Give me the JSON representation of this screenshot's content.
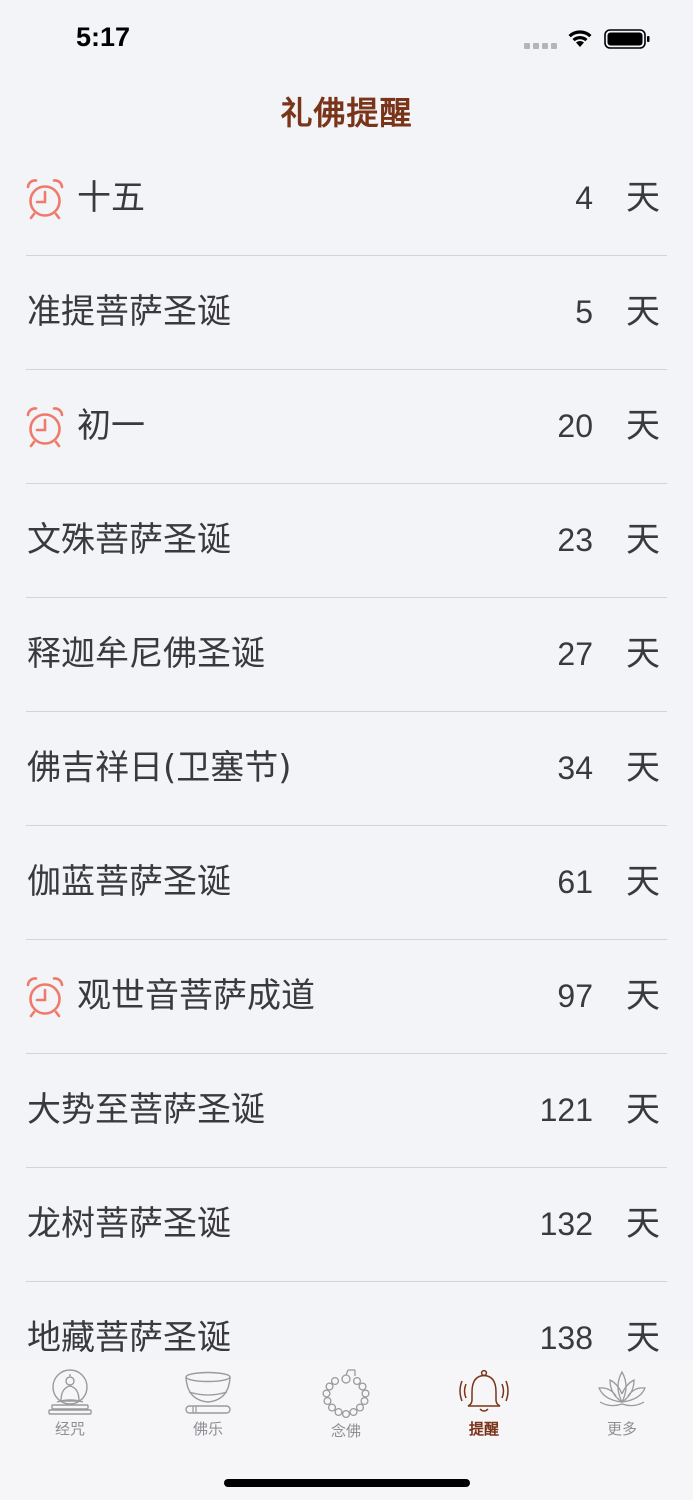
{
  "status": {
    "time": "5:17"
  },
  "header": {
    "title": "礼佛提醒"
  },
  "colors": {
    "accent": "#7a3419",
    "alarm": "#f07a6a",
    "background": "#f3f4f8"
  },
  "reminders": [
    {
      "name": "十五",
      "days": "4",
      "unit": "天",
      "alarm": true
    },
    {
      "name": "准提菩萨圣诞",
      "days": "5",
      "unit": "天",
      "alarm": false
    },
    {
      "name": "初一",
      "days": "20",
      "unit": "天",
      "alarm": true
    },
    {
      "name": "文殊菩萨圣诞",
      "days": "23",
      "unit": "天",
      "alarm": false
    },
    {
      "name": "释迦牟尼佛圣诞",
      "days": "27",
      "unit": "天",
      "alarm": false
    },
    {
      "name": "佛吉祥日(卫塞节)",
      "days": "34",
      "unit": "天",
      "alarm": false
    },
    {
      "name": "伽蓝菩萨圣诞",
      "days": "61",
      "unit": "天",
      "alarm": false
    },
    {
      "name": "观世音菩萨成道",
      "days": "97",
      "unit": "天",
      "alarm": true
    },
    {
      "name": "大势至菩萨圣诞",
      "days": "121",
      "unit": "天",
      "alarm": false
    },
    {
      "name": "龙树菩萨圣诞",
      "days": "132",
      "unit": "天",
      "alarm": false
    },
    {
      "name": "地藏菩萨圣诞",
      "days": "138",
      "unit": "天",
      "alarm": false
    }
  ],
  "tabs": [
    {
      "label": "经咒",
      "icon": "buddha-icon",
      "active": false
    },
    {
      "label": "佛乐",
      "icon": "singing-bowl-icon",
      "active": false
    },
    {
      "label": "念佛",
      "icon": "prayer-beads-icon",
      "active": false
    },
    {
      "label": "提醒",
      "icon": "bell-icon",
      "active": true
    },
    {
      "label": "更多",
      "icon": "lotus-icon",
      "active": false
    }
  ]
}
